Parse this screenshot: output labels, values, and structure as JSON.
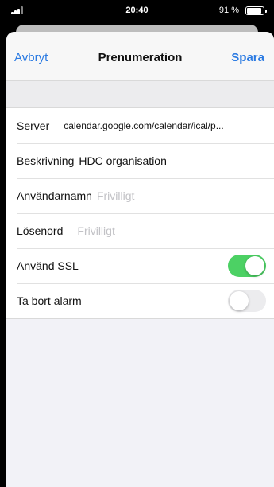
{
  "status_bar": {
    "time": "20:40",
    "battery_percent": "91 %"
  },
  "navbar": {
    "cancel_label": "Avbryt",
    "title": "Prenumeration",
    "save_label": "Spara"
  },
  "form": {
    "server": {
      "label": "Server",
      "value": "calendar.google.com/calendar/ical/p..."
    },
    "description": {
      "label": "Beskrivning",
      "value": "HDC organisation"
    },
    "username": {
      "label": "Användarnamn",
      "placeholder": "Frivilligt"
    },
    "password": {
      "label": "Lösenord",
      "placeholder": "Frivilligt"
    },
    "use_ssl": {
      "label": "Använd SSL",
      "on": true
    },
    "remove_alarms": {
      "label": "Ta bort alarm",
      "on": false
    }
  },
  "colors": {
    "accent": "#2a7ae2",
    "toggle_on": "#4cd164"
  }
}
